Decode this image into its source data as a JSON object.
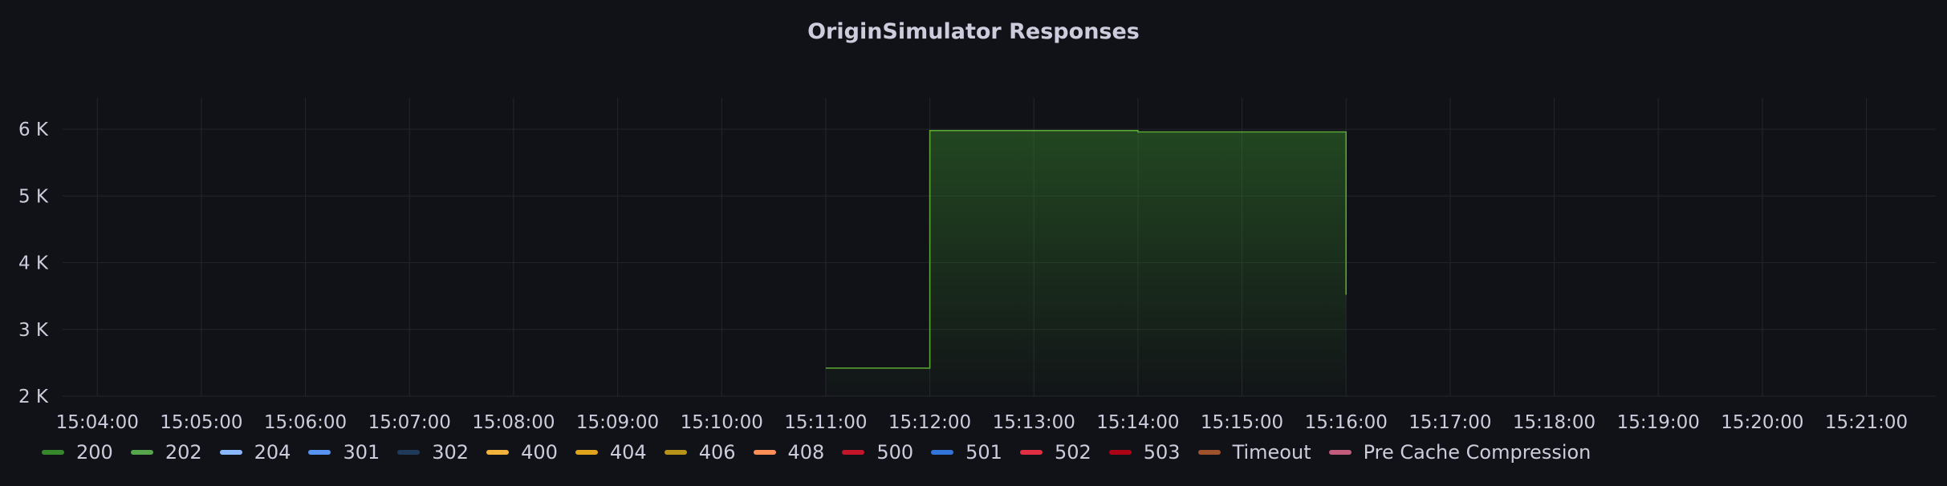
{
  "panel": {
    "title": "OriginSimulator Responses"
  },
  "chart_data": {
    "type": "area",
    "title": "OriginSimulator Responses",
    "xlabel": "",
    "ylabel": "",
    "x_ticks": [
      "15:04:00",
      "15:05:00",
      "15:06:00",
      "15:07:00",
      "15:08:00",
      "15:09:00",
      "15:10:00",
      "15:11:00",
      "15:12:00",
      "15:13:00",
      "15:14:00",
      "15:15:00",
      "15:16:00",
      "15:17:00",
      "15:18:00",
      "15:19:00",
      "15:20:00",
      "15:21:00"
    ],
    "x_range": [
      "15:03:40",
      "15:21:40"
    ],
    "y_ticks": [
      {
        "value": 2000,
        "label": "2 K"
      },
      {
        "value": 3000,
        "label": "3 K"
      },
      {
        "value": 4000,
        "label": "4 K"
      },
      {
        "value": 5000,
        "label": "5 K"
      },
      {
        "value": 6000,
        "label": "6 K"
      }
    ],
    "ylim": [
      2000,
      6350
    ],
    "grid": true,
    "legend_position": "bottom-left",
    "series": [
      {
        "name": "200",
        "color": "#37872d",
        "points": [
          {
            "x": "15:11:00",
            "y": 2420
          },
          {
            "x": "15:12:00",
            "y": 2420
          },
          {
            "x": "15:12:00",
            "y": 5980
          },
          {
            "x": "15:14:00",
            "y": 5980
          },
          {
            "x": "15:14:00",
            "y": 5960
          },
          {
            "x": "15:16:00",
            "y": 5960
          },
          {
            "x": "15:16:00",
            "y": 3520
          }
        ]
      }
    ],
    "legend": [
      {
        "name": "200",
        "color": "#37872d"
      },
      {
        "name": "202",
        "color": "#56a64b"
      },
      {
        "name": "204",
        "color": "#8ab8ff"
      },
      {
        "name": "301",
        "color": "#5794f2"
      },
      {
        "name": "302",
        "color": "#1f3a5a"
      },
      {
        "name": "400",
        "color": "#f2b23c"
      },
      {
        "name": "404",
        "color": "#e0a31c"
      },
      {
        "name": "406",
        "color": "#b8931a"
      },
      {
        "name": "408",
        "color": "#ff8f56"
      },
      {
        "name": "500",
        "color": "#c4162a"
      },
      {
        "name": "501",
        "color": "#3274d9"
      },
      {
        "name": "502",
        "color": "#e02f44"
      },
      {
        "name": "503",
        "color": "#ad0317"
      },
      {
        "name": "Timeout",
        "color": "#a0522d"
      },
      {
        "name": "Pre Cache Compression",
        "color": "#c15c7c"
      }
    ]
  }
}
